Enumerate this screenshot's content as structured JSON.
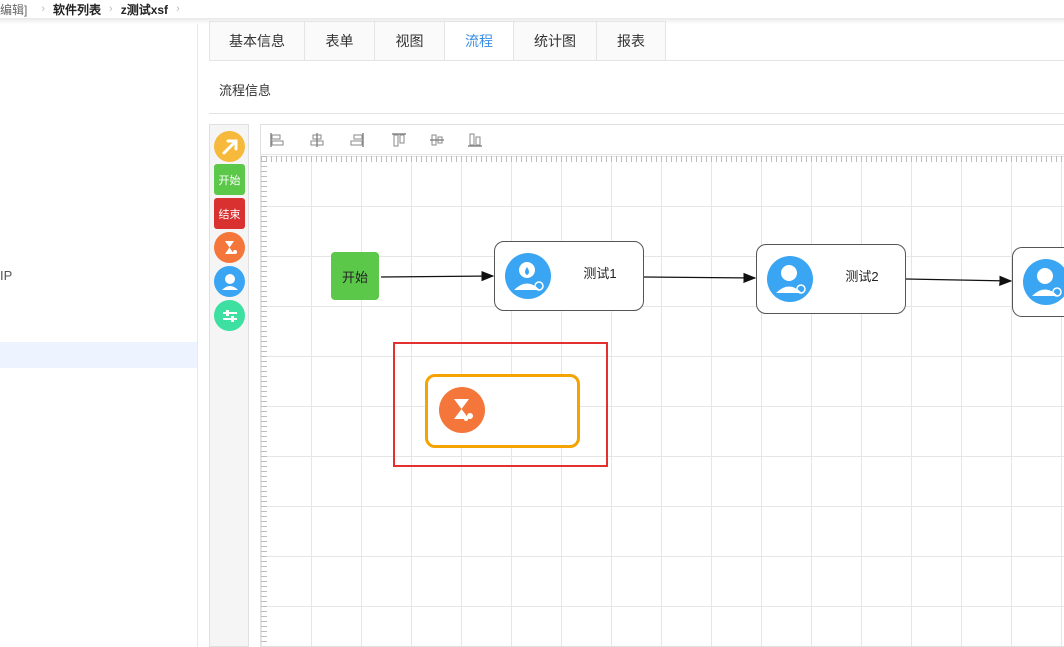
{
  "breadcrumb": {
    "items": [
      "编辑]",
      "软件列表",
      "z测试xsf"
    ]
  },
  "leftnav": {
    "partial_label": "IP"
  },
  "tabs": [
    {
      "label": "基本信息"
    },
    {
      "label": "表单"
    },
    {
      "label": "视图"
    },
    {
      "label": "流程",
      "active": true
    },
    {
      "label": "统计图"
    },
    {
      "label": "报表"
    }
  ],
  "section": {
    "title": "流程信息"
  },
  "palette": {
    "items": [
      {
        "name": "pointer-tool",
        "icon": "arrow-up-right-icon",
        "color": "#f6b93b"
      },
      {
        "name": "start-node-tool",
        "label": "开始",
        "color": "#5cc84a"
      },
      {
        "name": "end-node-tool",
        "label": "结束",
        "color": "#d93030"
      },
      {
        "name": "timer-node-tool",
        "icon": "hourglass-icon",
        "color": "#f5763a"
      },
      {
        "name": "user-task-tool",
        "icon": "user-icon",
        "color": "#3aa5f2"
      },
      {
        "name": "gateway-tool",
        "icon": "sliders-icon",
        "color": "#3de0a0"
      }
    ]
  },
  "toolbar": {
    "tools": [
      "align-left-icon",
      "align-center-icon",
      "align-right-icon",
      "align-top-icon",
      "align-middle-icon",
      "align-bottom-icon"
    ]
  },
  "flow": {
    "start_label": "开始",
    "tasks": [
      {
        "label": "测试1"
      },
      {
        "label": "测试2"
      },
      {
        "label": ""
      }
    ],
    "timer_label": ""
  },
  "colors": {
    "accent": "#3a8ee6",
    "start": "#5cc84a",
    "end": "#d93030",
    "timer": "#f5763a",
    "user": "#3aa5f2",
    "selected_border": "#f5a300",
    "highlight": "#e53030"
  }
}
